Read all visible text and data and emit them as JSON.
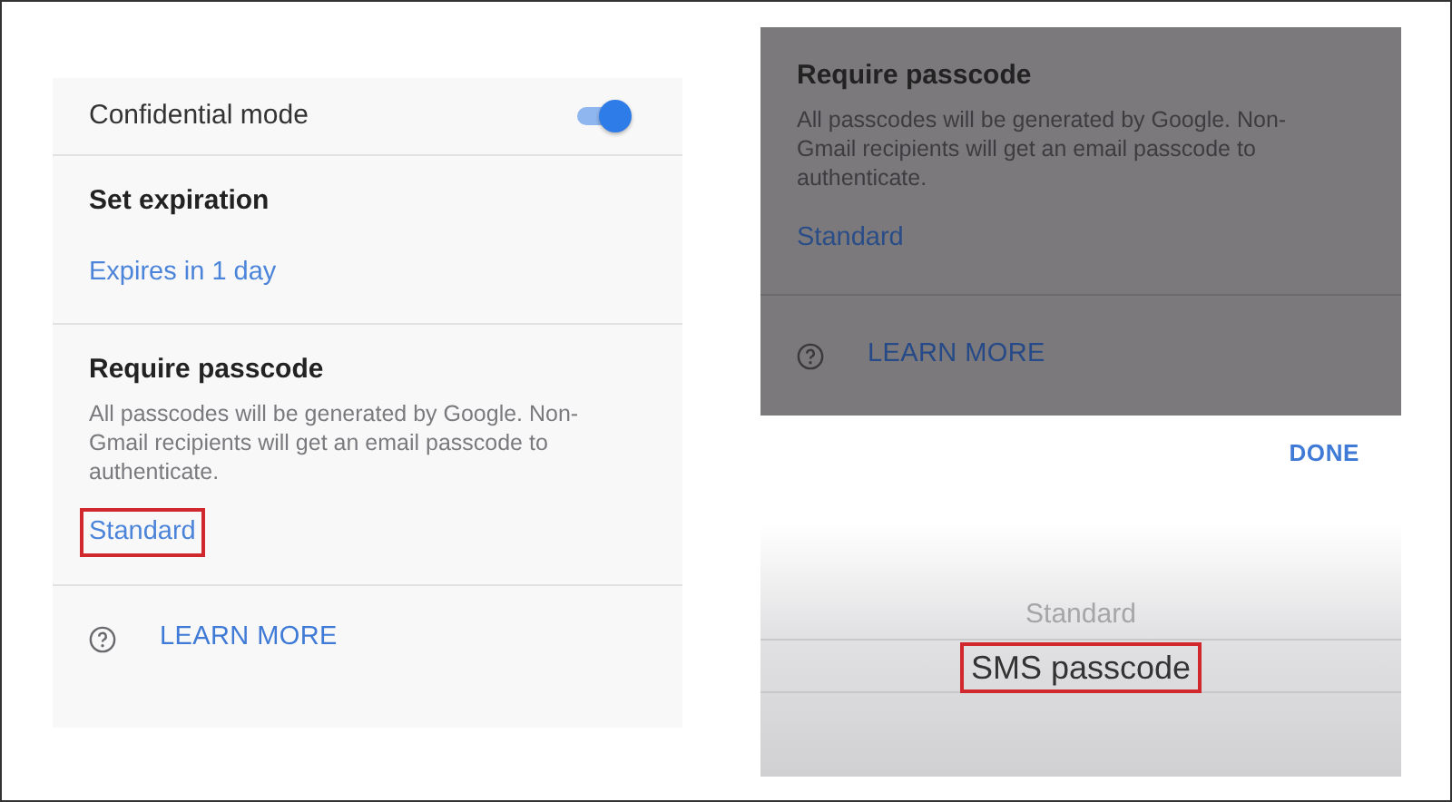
{
  "panels": [
    {
      "dimmed": false,
      "confidential": {
        "label": "Confidential mode",
        "on": true
      },
      "expiration": {
        "title": "Set expiration",
        "value": "Expires in 1 day"
      },
      "passcode": {
        "title": "Require passcode",
        "description": "All passcodes will be generated by Google. Non-Gmail recipients will get an email passcode to authenticate.",
        "value": "Standard",
        "highlighted": true
      },
      "learn_more": "LEARN MORE"
    },
    {
      "dimmed": true,
      "passcode": {
        "title": "Require passcode",
        "description": "All passcodes will be generated by Google. Non-Gmail recipients will get an email passcode to authenticate.",
        "value": "Standard",
        "highlighted": false
      },
      "learn_more": "LEARN MORE",
      "picker": {
        "done": "DONE",
        "options": [
          {
            "label": "Standard",
            "selected": false,
            "highlighted": false
          },
          {
            "label": "SMS passcode",
            "selected": true,
            "highlighted": true
          }
        ]
      }
    }
  ]
}
